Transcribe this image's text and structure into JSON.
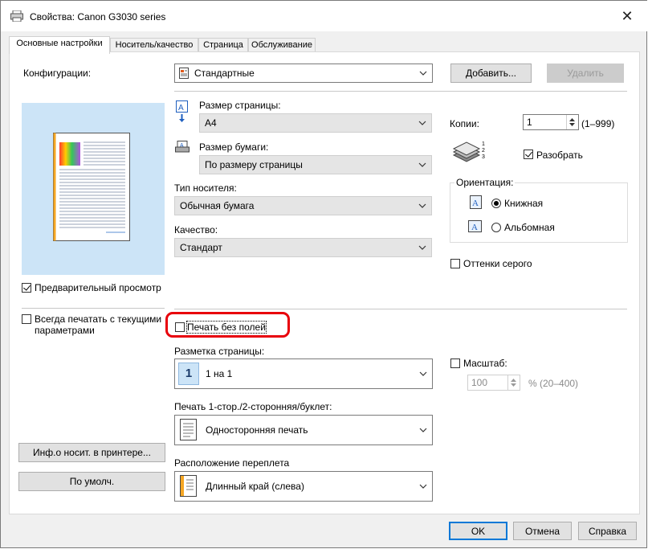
{
  "window": {
    "title": "Свойства: Canon G3030 series",
    "close_glyph": "✕"
  },
  "tabs": [
    {
      "label": "Основные настройки",
      "active": true
    },
    {
      "label": "Носитель/качество",
      "active": false
    },
    {
      "label": "Страница",
      "active": false
    },
    {
      "label": "Обслуживание",
      "active": false
    }
  ],
  "config": {
    "label": "Конфигурации:",
    "value": "Стандартные",
    "add_button": "Добавить...",
    "delete_button": "Удалить"
  },
  "preview": {
    "checkbox_label": "Предварительный просмотр",
    "checked": true
  },
  "always_print": {
    "label_line1": "Всегда печатать с текущими",
    "label_line2": "параметрами",
    "checked": false
  },
  "page_size": {
    "label": "Размер страницы:",
    "value": "A4"
  },
  "paper_size": {
    "label": "Размер бумаги:",
    "value": "По размеру страницы"
  },
  "media_type": {
    "label": "Тип носителя:",
    "value": "Обычная бумага"
  },
  "quality": {
    "label": "Качество:",
    "value": "Стандарт"
  },
  "copies": {
    "label": "Копии:",
    "value": "1",
    "range": "(1–999)",
    "collate_label": "Разобрать",
    "collate_checked": true
  },
  "orientation": {
    "group_label": "Ориентация:",
    "portrait": "Книжная",
    "landscape": "Альбомная",
    "selected": "portrait"
  },
  "grayscale": {
    "label": "Оттенки серого",
    "checked": false
  },
  "borderless": {
    "label": "Печать без полей",
    "checked": false,
    "highlight_color": "#e8000b"
  },
  "page_layout": {
    "label": "Разметка страницы:",
    "value": "1 на 1",
    "icon_text": "1"
  },
  "scale": {
    "label": "Масштаб:",
    "checked": false,
    "value": "100",
    "range": "% (20–400)"
  },
  "duplex": {
    "label": "Печать 1-стор./2-сторонняя/буклет:",
    "value": "Односторонняя печать"
  },
  "binding": {
    "label": "Расположение переплета",
    "value": "Длинный край (слева)"
  },
  "buttons": {
    "media_info": "Инф.о носит. в принтере...",
    "defaults": "По умолч.",
    "ok": "OK",
    "cancel": "Отмена",
    "help": "Справка"
  },
  "colors": {
    "accent": "#0078d7",
    "preview_bg": "#cce4f7"
  }
}
